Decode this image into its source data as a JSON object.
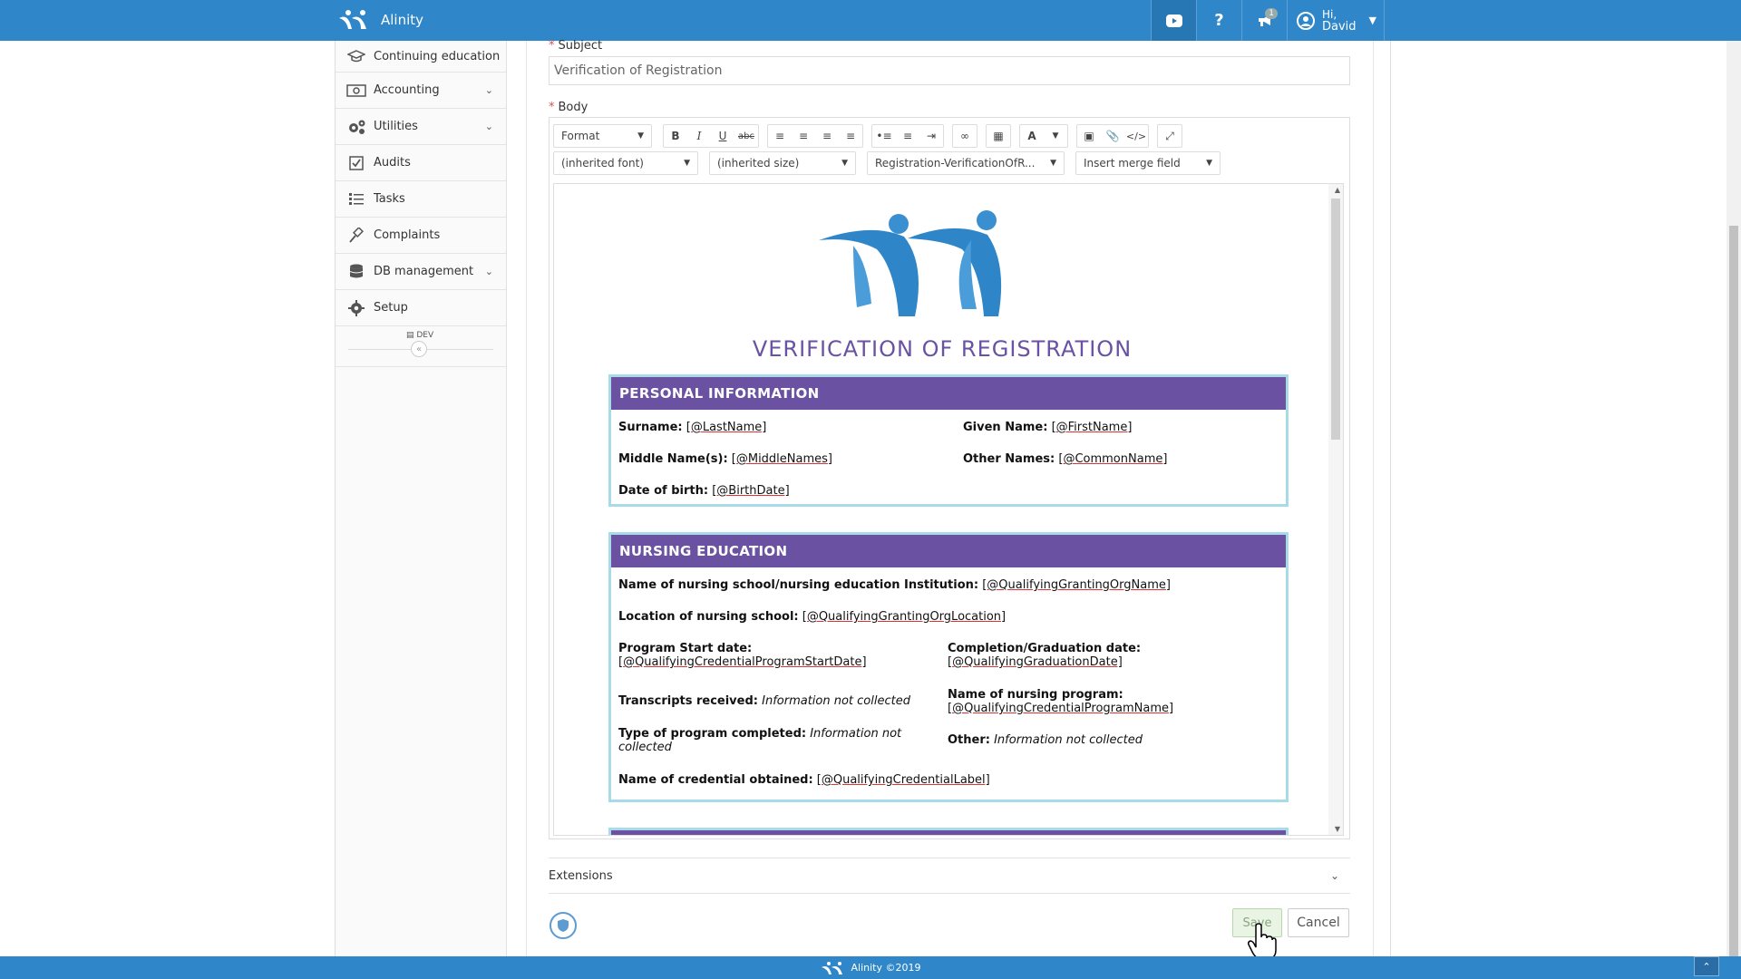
{
  "app": {
    "name": "Alinity"
  },
  "header": {
    "notifications_count": "1",
    "user_greeting": "Hi,",
    "user_name": "David"
  },
  "sidebar": {
    "items": [
      {
        "label": "Continuing education",
        "icon": "graduation-cap-icon"
      },
      {
        "label": "Accounting",
        "icon": "money-icon"
      },
      {
        "label": "Utilities",
        "icon": "cogs-icon"
      },
      {
        "label": "Audits",
        "icon": "checkbox-icon"
      },
      {
        "label": "Tasks",
        "icon": "tasks-icon"
      },
      {
        "label": "Complaints",
        "icon": "gavel-icon"
      },
      {
        "label": "DB management",
        "icon": "database-icon"
      },
      {
        "label": "Setup",
        "icon": "gear-icon"
      }
    ],
    "env_label": "DEV"
  },
  "form": {
    "subject_label": "Subject",
    "subject_value": "Verification of Registration",
    "body_label": "Body",
    "extensions_label": "Extensions",
    "save_label": "Save",
    "cancel_label": "Cancel"
  },
  "editor": {
    "format_select": "Format",
    "font_select": "(inherited font)",
    "size_select": "(inherited size)",
    "template_select": "Registration-VerificationOfR...",
    "merge_select": "Insert merge field"
  },
  "document": {
    "title": "VERIFICATION OF REGISTRATION",
    "personal": {
      "heading": "PERSONAL INFORMATION",
      "surname_label": "Surname:",
      "surname_value": "[@LastName]",
      "given_label": "Given Name:",
      "given_value": "[@FirstName]",
      "middle_label": "Middle Name(s):",
      "middle_value": "[@MiddleNames]",
      "other_label": "Other Names:",
      "other_value": "[@CommonName]",
      "dob_label": "Date of birth:",
      "dob_value": "[@BirthDate]"
    },
    "education": {
      "heading": "NURSING EDUCATION",
      "school_label": "Name of nursing school/nursing education Institution:",
      "school_value": "[@QualifyingGrantingOrgName]",
      "location_label": "Location of nursing school:",
      "location_value": "[@QualifyingGrantingOrgLocation]",
      "start_label": "Program Start date:",
      "start_value": "[@QualifyingCredentialProgramStartDate]",
      "completion_label": "Completion/Graduation date:",
      "completion_value": "[@QualifyingGraduationDate]",
      "transcripts_label": "Transcripts received:",
      "transcripts_value": "Information not collected",
      "program_name_label": "Name of nursing program:",
      "program_name_value": "[@QualifyingCredentialProgramName]",
      "type_label": "Type of program completed:",
      "type_value_1": "Information not",
      "type_value_2": "collected",
      "other_label": "Other:",
      "other_value": "Information not collected",
      "credential_label": "Name of credential obtained:",
      "credential_value": "[@QualifyingCredentialLabel]"
    }
  },
  "footer": {
    "text": "Alinity ©2019"
  },
  "colors": {
    "primary": "#2f86c8",
    "purple": "#6b51a1",
    "section_border": "#a7dbe8"
  }
}
